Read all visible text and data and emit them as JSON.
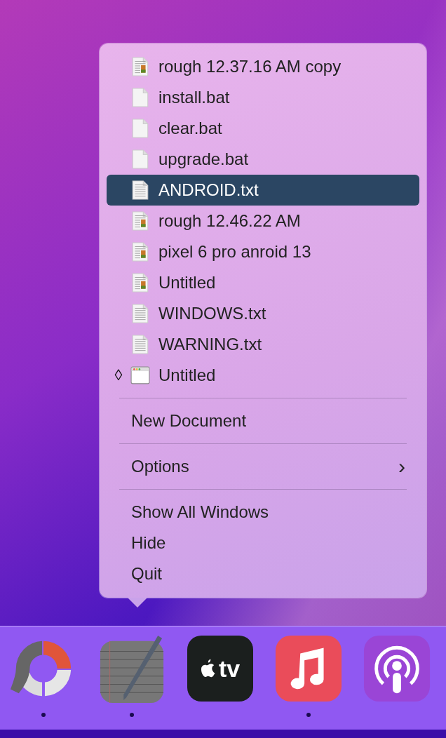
{
  "menu": {
    "documents": [
      {
        "name": "rough 12.37.16 AM copy",
        "kind": "rich",
        "selected": false
      },
      {
        "name": "install.bat",
        "kind": "blank",
        "selected": false
      },
      {
        "name": "clear.bat",
        "kind": "blank",
        "selected": false
      },
      {
        "name": "upgrade.bat",
        "kind": "blank",
        "selected": false
      },
      {
        "name": "ANDROID.txt",
        "kind": "text",
        "selected": true
      },
      {
        "name": "rough 12.46.22 AM",
        "kind": "rich",
        "selected": false
      },
      {
        "name": "pixel 6 pro anroid 13",
        "kind": "rich",
        "selected": false
      },
      {
        "name": "Untitled",
        "kind": "rich",
        "selected": false
      },
      {
        "name": "WINDOWS.txt",
        "kind": "text",
        "selected": false
      },
      {
        "name": "WARNING.txt",
        "kind": "text",
        "selected": false
      },
      {
        "name": "Untitled",
        "kind": "window",
        "selected": false,
        "marker": "◊"
      }
    ],
    "sections": [
      [
        {
          "label": "New Document"
        }
      ],
      [
        {
          "label": "Options",
          "arrow": "›"
        }
      ],
      [
        {
          "label": "Show All Windows"
        },
        {
          "label": "Hide"
        },
        {
          "label": "Quit"
        }
      ]
    ]
  },
  "dock": [
    {
      "kind": "ring",
      "running": true
    },
    {
      "kind": "notepad",
      "running": true
    },
    {
      "kind": "tv",
      "label": "tv",
      "running": false
    },
    {
      "kind": "music",
      "running": true
    },
    {
      "kind": "podcast",
      "running": false
    }
  ]
}
